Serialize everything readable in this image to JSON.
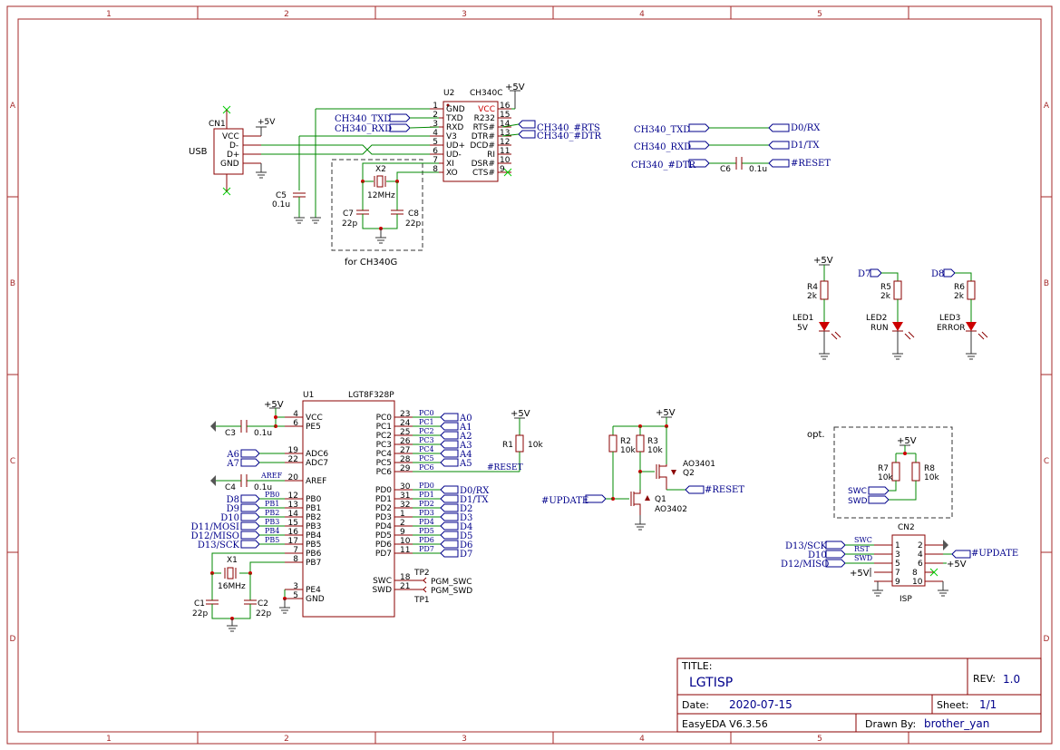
{
  "frame": {
    "columns": [
      "1",
      "2",
      "3",
      "4",
      "5"
    ],
    "rows": [
      "A",
      "B",
      "C",
      "D"
    ]
  },
  "usb": {
    "ref": "CN1",
    "name": "USB",
    "power": "+5V",
    "pins": [
      "VCC",
      "D-",
      "D+",
      "GND"
    ]
  },
  "u2": {
    "ref": "U2",
    "part": "CH340C",
    "power": "+5V",
    "left_pins": [
      {
        "num": "1",
        "name": "GND"
      },
      {
        "num": "2",
        "name": "TXD"
      },
      {
        "num": "3",
        "name": "RXD"
      },
      {
        "num": "4",
        "name": "V3"
      },
      {
        "num": "5",
        "name": "UD+"
      },
      {
        "num": "6",
        "name": "UD-"
      },
      {
        "num": "7",
        "name": "XI"
      },
      {
        "num": "8",
        "name": "XO"
      }
    ],
    "right_pins": [
      {
        "num": "16",
        "name": "VCC"
      },
      {
        "num": "15",
        "name": "R232"
      },
      {
        "num": "14",
        "name": "RTS#"
      },
      {
        "num": "13",
        "name": "DTR#"
      },
      {
        "num": "12",
        "name": "DCD#"
      },
      {
        "num": "11",
        "name": "RI"
      },
      {
        "num": "10",
        "name": "DSR#"
      },
      {
        "num": "9",
        "name": "CTS#"
      }
    ],
    "net_in": [
      "CH340_TXD",
      "CH340_RXD"
    ],
    "net_out": [
      "CH340_#RTS",
      "CH340_#DTR"
    ]
  },
  "crystal_block": {
    "x2": "X2",
    "x2_value": "12MHz",
    "c7": "C7",
    "c7_value": "22p",
    "c8": "C8",
    "c8_value": "22p",
    "caption": "for CH340G"
  },
  "c5": {
    "ref": "C5",
    "value": "0.1u"
  },
  "serial_map": {
    "rows": [
      {
        "from": "CH340_TXD",
        "to": "D0/RX"
      },
      {
        "from": "CH340_RXD",
        "to": "D1/TX"
      },
      {
        "from": "CH340_#DTR",
        "to": "#RESET"
      }
    ],
    "cap_ref": "C6",
    "cap_value": "0.1u"
  },
  "leds": [
    {
      "net": "+5V",
      "r_ref": "R4",
      "r_val": "2k",
      "led_ref": "LED1",
      "label": "5V"
    },
    {
      "net": "D7",
      "r_ref": "R5",
      "r_val": "2k",
      "led_ref": "LED2",
      "label": "RUN"
    },
    {
      "net": "D8",
      "r_ref": "R6",
      "r_val": "2k",
      "led_ref": "LED3",
      "label": "ERROR"
    }
  ],
  "u1": {
    "ref": "U1",
    "part": "LGT8F328P",
    "power": "+5V",
    "left_pins": [
      {
        "num": "4",
        "name": "VCC"
      },
      {
        "num": "6",
        "name": "PE5"
      },
      {
        "num": "19",
        "name": "ADC6"
      },
      {
        "num": "22",
        "name": "ADC7"
      },
      {
        "num": "20",
        "name": "AREF"
      },
      {
        "num": "12",
        "name": "PB0"
      },
      {
        "num": "13",
        "name": "PB1"
      },
      {
        "num": "14",
        "name": "PB2"
      },
      {
        "num": "15",
        "name": "PB3"
      },
      {
        "num": "16",
        "name": "PB4"
      },
      {
        "num": "17",
        "name": "PB5"
      },
      {
        "num": "7",
        "name": "PB6"
      },
      {
        "num": "8",
        "name": "PB7"
      },
      {
        "num": "3",
        "name": "PE4"
      },
      {
        "num": "5",
        "name": "GND"
      }
    ],
    "right_pins": [
      {
        "num": "23",
        "name": "PC0"
      },
      {
        "num": "24",
        "name": "PC1"
      },
      {
        "num": "25",
        "name": "PC2"
      },
      {
        "num": "26",
        "name": "PC3"
      },
      {
        "num": "27",
        "name": "PC4"
      },
      {
        "num": "28",
        "name": "PC5"
      },
      {
        "num": "29",
        "name": "PC6"
      },
      {
        "num": "30",
        "name": "PD0"
      },
      {
        "num": "31",
        "name": "PD1"
      },
      {
        "num": "32",
        "name": "PD2"
      },
      {
        "num": "1",
        "name": "PD3"
      },
      {
        "num": "2",
        "name": "PD4"
      },
      {
        "num": "9",
        "name": "PD5"
      },
      {
        "num": "10",
        "name": "PD6"
      },
      {
        "num": "11",
        "name": "PD7"
      },
      {
        "num": "18",
        "name": "SWC"
      },
      {
        "num": "21",
        "name": "SWD"
      }
    ],
    "left_nets": [
      "A6",
      "A7",
      "D8",
      "D9",
      "D10",
      "D11/MOSI",
      "D12/MISO",
      "D13/SCK"
    ],
    "left_wire_labels": [
      "PB0",
      "PB1",
      "PB2",
      "PB3",
      "PB4",
      "PB5",
      "AREF"
    ],
    "right_nets": [
      "A0",
      "A1",
      "A2",
      "A3",
      "A4",
      "A5",
      "D0/RX",
      "D1/TX",
      "D2",
      "D3",
      "D4",
      "D5",
      "D6",
      "D7"
    ],
    "right_wire_labels": [
      "PC0",
      "PC1",
      "PC2",
      "PC3",
      "PC4",
      "PC5",
      "PC6",
      "PD0",
      "PD1",
      "PD2",
      "PD3",
      "PD4",
      "PD5",
      "PD6",
      "PD7"
    ],
    "reset_label": "#RESET",
    "c3": "C3",
    "c3_value": "0.1u",
    "c4": "C4",
    "c4_value": "0.1u",
    "x1": "X1",
    "x1_value": "16MHz",
    "c1": "C1",
    "c1_value": "22p",
    "c2": "C2",
    "c2_value": "22p",
    "tp2": "TP2",
    "tp1": "TP1",
    "pgm_swc": "PGM_SWC",
    "pgm_swd": "PGM_SWD"
  },
  "r1": {
    "ref": "R1",
    "value": "10k",
    "power": "+5V"
  },
  "update_ckt": {
    "power": "+5V",
    "r2": "R2",
    "r2_value": "10k",
    "r3": "R3",
    "r3_value": "10k",
    "q2_part": "AO3401",
    "q2": "Q2",
    "q1": "Q1",
    "q1_part": "AO3402",
    "in_net": "#UPDATE",
    "out_net": "#RESET"
  },
  "opt_block": {
    "title": "opt.",
    "power": "+5V",
    "r7": "R7",
    "r7_value": "10k",
    "r8": "R8",
    "r8_value": "10k",
    "nets": [
      "SWC",
      "SWD"
    ]
  },
  "cn2": {
    "ref": "CN2",
    "name": "ISP",
    "left_nets": [
      "D13/SCK",
      "D10",
      "D12/MISO",
      "+5V"
    ],
    "left_wire_labels": [
      "SWC",
      "RST",
      "SWD"
    ],
    "pins_left": [
      "1",
      "3",
      "5",
      "7",
      "9"
    ],
    "pins_right": [
      "2",
      "4",
      "6",
      "8",
      "10"
    ],
    "right_nets": [
      "#UPDATE",
      "+5V"
    ]
  },
  "title_block": {
    "title_label": "TITLE:",
    "title": "LGTISP",
    "rev_label": "REV:",
    "rev": "1.0",
    "date_label": "Date:",
    "date": "2020-07-15",
    "sheet_label": "Sheet:",
    "sheet": "1/1",
    "tool": "EasyEDA V6.3.56",
    "drawn_label": "Drawn By:",
    "drawn_by": "brother_yan"
  },
  "colors": {
    "frame": "#a52a2a",
    "wire": "#008800",
    "net": "#00008b",
    "pin": "#8b0000",
    "junction": "#cc0000"
  }
}
